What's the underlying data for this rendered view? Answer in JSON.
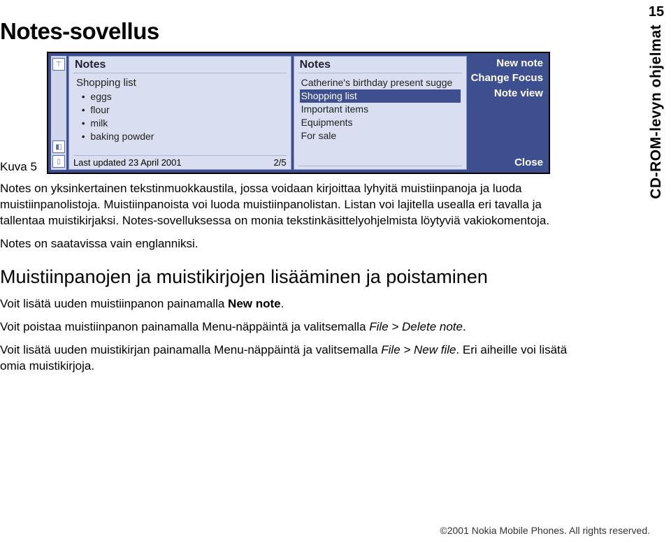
{
  "page": {
    "number": "15",
    "sidelabel": "CD-ROM-levyn ohjelmat"
  },
  "heading": "Notes-sovellus",
  "figure_label": "Kuva 5",
  "screenshot": {
    "left_pane": {
      "title": "Notes",
      "subtitle": "Shopping list",
      "items": [
        "eggs",
        "flour",
        "milk",
        "baking powder"
      ],
      "footer_left": "Last updated 23 April 2001",
      "footer_right": "2/5"
    },
    "right_pane": {
      "title": "Notes",
      "items": [
        "Catherine's birthday present sugge",
        "Shopping list",
        "Important items",
        "Equipments",
        "For sale"
      ],
      "selected_index": 1
    },
    "menu": {
      "items": [
        "New note",
        "Change Focus",
        "Note view",
        "Close"
      ]
    }
  },
  "paragraphs": {
    "p1": "Notes on yksinkertainen tekstinmuokkaustila, jossa voidaan kirjoittaa lyhyitä muistiinpanoja ja luoda muistiinpanolistoja. Muistiinpanoista voi luoda muistiinpanolistan. Listan voi lajitella usealla eri tavalla ja tallentaa muistikirjaksi. Notes-sovelluksessa on monia tekstinkäsittelyohjelmista löytyviä vakiokomentoja.",
    "p2": "Notes on saatavissa vain englanniksi.",
    "h2": "Muistiinpanojen ja muistikirjojen lisääminen ja poistaminen",
    "p3a": "Voit lisätä uuden muistiinpanon painamalla ",
    "p3b": "New note",
    "p3c": ".",
    "p4a": "Voit poistaa muistiinpanon painamalla Menu-näppäintä ja valitsemalla ",
    "p4b": "File > Delete note",
    "p4c": ".",
    "p5a": "Voit lisätä uuden muistikirjan painamalla Menu-näppäintä ja valitsemalla ",
    "p5b": "File > New file",
    "p5c": ". Eri aiheille voi lisätä omia muistikirjoja."
  },
  "footer": "©2001 Nokia Mobile Phones. All rights reserved."
}
